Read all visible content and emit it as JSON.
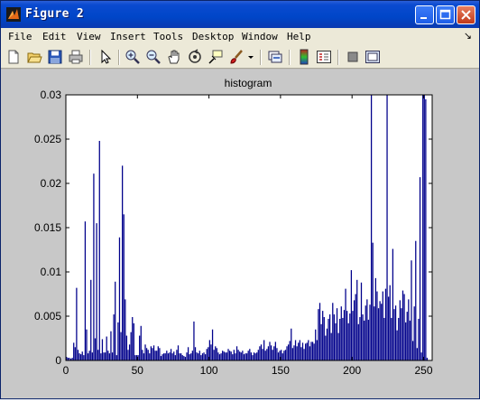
{
  "window": {
    "title": "Figure 2"
  },
  "menu": [
    "File",
    "Edit",
    "View",
    "Insert",
    "Tools",
    "Desktop",
    "Window",
    "Help"
  ],
  "menu_overflow": "↘",
  "toolbar": [
    "new-figure",
    "open-file",
    "save-figure",
    "print-figure",
    "edit-plot",
    "zoom-in",
    "zoom-out",
    "pan",
    "rotate-3d",
    "data-cursor",
    "brush",
    "brush-dropdown",
    "link-plot",
    "insert-colorbar",
    "insert-legend",
    "hide-plot-tools",
    "show-plot-tools"
  ],
  "colors": {
    "bar": "#00008b",
    "plot_bg": "#ffffff",
    "figure_bg": "#c8c8c8",
    "titlebar": "#0046c8"
  },
  "chart_data": {
    "type": "bar",
    "title": "histogram",
    "xlabel": "",
    "ylabel": "",
    "xlim": [
      0,
      256
    ],
    "ylim": [
      0,
      0.03
    ],
    "x_ticks": [
      "0",
      "50",
      "100",
      "150",
      "200",
      "250"
    ],
    "y_ticks": [
      "0",
      "0.005",
      "0.01",
      "0.015",
      "0.02",
      "0.025",
      "0.03"
    ],
    "grid": false,
    "x": [
      0,
      1,
      2,
      3,
      4,
      5,
      6,
      7,
      8,
      9,
      10,
      11,
      12,
      13,
      14,
      15,
      16,
      17,
      18,
      19,
      20,
      21,
      22,
      23,
      24,
      25,
      26,
      27,
      28,
      29,
      30,
      31,
      32,
      33,
      34,
      35,
      36,
      37,
      38,
      39,
      40,
      41,
      42,
      43,
      44,
      45,
      46,
      47,
      48,
      49,
      50,
      51,
      52,
      53,
      54,
      55,
      56,
      57,
      58,
      59,
      60,
      61,
      62,
      63,
      64,
      65,
      66,
      67,
      68,
      69,
      70,
      71,
      72,
      73,
      74,
      75,
      76,
      77,
      78,
      79,
      80,
      81,
      82,
      83,
      84,
      85,
      86,
      87,
      88,
      89,
      90,
      91,
      92,
      93,
      94,
      95,
      96,
      97,
      98,
      99,
      100,
      101,
      102,
      103,
      104,
      105,
      106,
      107,
      108,
      109,
      110,
      111,
      112,
      113,
      114,
      115,
      116,
      117,
      118,
      119,
      120,
      121,
      122,
      123,
      124,
      125,
      126,
      127,
      128,
      129,
      130,
      131,
      132,
      133,
      134,
      135,
      136,
      137,
      138,
      139,
      140,
      141,
      142,
      143,
      144,
      145,
      146,
      147,
      148,
      149,
      150,
      151,
      152,
      153,
      154,
      155,
      156,
      157,
      158,
      159,
      160,
      161,
      162,
      163,
      164,
      165,
      166,
      167,
      168,
      169,
      170,
      171,
      172,
      173,
      174,
      175,
      176,
      177,
      178,
      179,
      180,
      181,
      182,
      183,
      184,
      185,
      186,
      187,
      188,
      189,
      190,
      191,
      192,
      193,
      194,
      195,
      196,
      197,
      198,
      199,
      200,
      201,
      202,
      203,
      204,
      205,
      206,
      207,
      208,
      209,
      210,
      211,
      212,
      213,
      214,
      215,
      216,
      217,
      218,
      219,
      220,
      221,
      222,
      223,
      224,
      225,
      226,
      227,
      228,
      229,
      230,
      231,
      232,
      233,
      234,
      235,
      236,
      237,
      238,
      239,
      240,
      241,
      242,
      243,
      244,
      245,
      246,
      247,
      248,
      249,
      250,
      251,
      252,
      253,
      254,
      255
    ],
    "values": [
      0.0004,
      0.0003,
      0.0003,
      0.0002,
      0.0003,
      0.002,
      0.0015,
      0.0082,
      0.0012,
      0.0008,
      0.0007,
      0.001,
      0.0006,
      0.0157,
      0.0035,
      0.0008,
      0.0011,
      0.0091,
      0.0009,
      0.0211,
      0.0025,
      0.0155,
      0.0012,
      0.0248,
      0.0008,
      0.0024,
      0.0009,
      0.0009,
      0.0027,
      0.0011,
      0.0008,
      0.0033,
      0.0009,
      0.0052,
      0.0089,
      0.0006,
      0.0043,
      0.0139,
      0.0032,
      0.022,
      0.0165,
      0.0069,
      0.0028,
      0.0012,
      0.0018,
      0.0032,
      0.0049,
      0.0042,
      0.0006,
      0.0006,
      0.0006,
      0.0028,
      0.0039,
      0.0012,
      0.0008,
      0.0018,
      0.0014,
      0.0012,
      0.0008,
      0.0016,
      0.0014,
      0.0017,
      0.0011,
      0.0011,
      0.0016,
      0.0014,
      0.0005,
      0.0007,
      0.0008,
      0.0008,
      0.0011,
      0.0008,
      0.0009,
      0.0013,
      0.0008,
      0.001,
      0.0006,
      0.0012,
      0.0017,
      0.0008,
      0.0008,
      0.0006,
      0.0005,
      0.0004,
      0.0009,
      0.0015,
      0.0007,
      0.0008,
      0.0011,
      0.0044,
      0.0015,
      0.0009,
      0.0008,
      0.0011,
      0.0006,
      0.0008,
      0.0009,
      0.0007,
      0.0013,
      0.0015,
      0.0023,
      0.0018,
      0.0035,
      0.0012,
      0.0016,
      0.0014,
      0.0009,
      0.0007,
      0.0008,
      0.0011,
      0.001,
      0.0009,
      0.0009,
      0.0013,
      0.0011,
      0.001,
      0.0007,
      0.0012,
      0.0008,
      0.0016,
      0.0012,
      0.001,
      0.0009,
      0.0011,
      0.0007,
      0.0008,
      0.0008,
      0.0011,
      0.0013,
      0.0009,
      0.0006,
      0.0009,
      0.0008,
      0.0009,
      0.0012,
      0.0016,
      0.0018,
      0.0013,
      0.0023,
      0.0011,
      0.0013,
      0.0016,
      0.0021,
      0.0017,
      0.0012,
      0.0016,
      0.0021,
      0.0014,
      0.0009,
      0.0011,
      0.0012,
      0.0008,
      0.0011,
      0.0012,
      0.0016,
      0.0018,
      0.0022,
      0.0036,
      0.0014,
      0.0017,
      0.0023,
      0.0016,
      0.002,
      0.0023,
      0.0015,
      0.002,
      0.0013,
      0.0019,
      0.002,
      0.0023,
      0.0016,
      0.0021,
      0.0021,
      0.0019,
      0.0035,
      0.0023,
      0.0058,
      0.0065,
      0.0041,
      0.0056,
      0.0049,
      0.0028,
      0.0036,
      0.0047,
      0.0052,
      0.0031,
      0.0065,
      0.0052,
      0.0042,
      0.0059,
      0.0031,
      0.0047,
      0.0061,
      0.0048,
      0.0057,
      0.0081,
      0.0056,
      0.0042,
      0.0053,
      0.0102,
      0.0056,
      0.0068,
      0.0075,
      0.0091,
      0.0041,
      0.0049,
      0.0088,
      0.0052,
      0.0045,
      0.0062,
      0.0069,
      0.0046,
      0.0063,
      0.03,
      0.0133,
      0.0061,
      0.0093,
      0.0078,
      0.0059,
      0.0067,
      0.0064,
      0.0078,
      0.0048,
      0.0081,
      0.03,
      0.0072,
      0.0085,
      0.0048,
      0.0126,
      0.0058,
      0.0062,
      0.0034,
      0.0048,
      0.0068,
      0.0059,
      0.0079,
      0.0075,
      0.0043,
      0.0055,
      0.0069,
      0.0045,
      0.0113,
      0.0022,
      0.0061,
      0.0135,
      0.0014,
      0.0047,
      0.0207,
      0.0009,
      0.03,
      0.03,
      0.0295,
      0.0003
    ]
  }
}
